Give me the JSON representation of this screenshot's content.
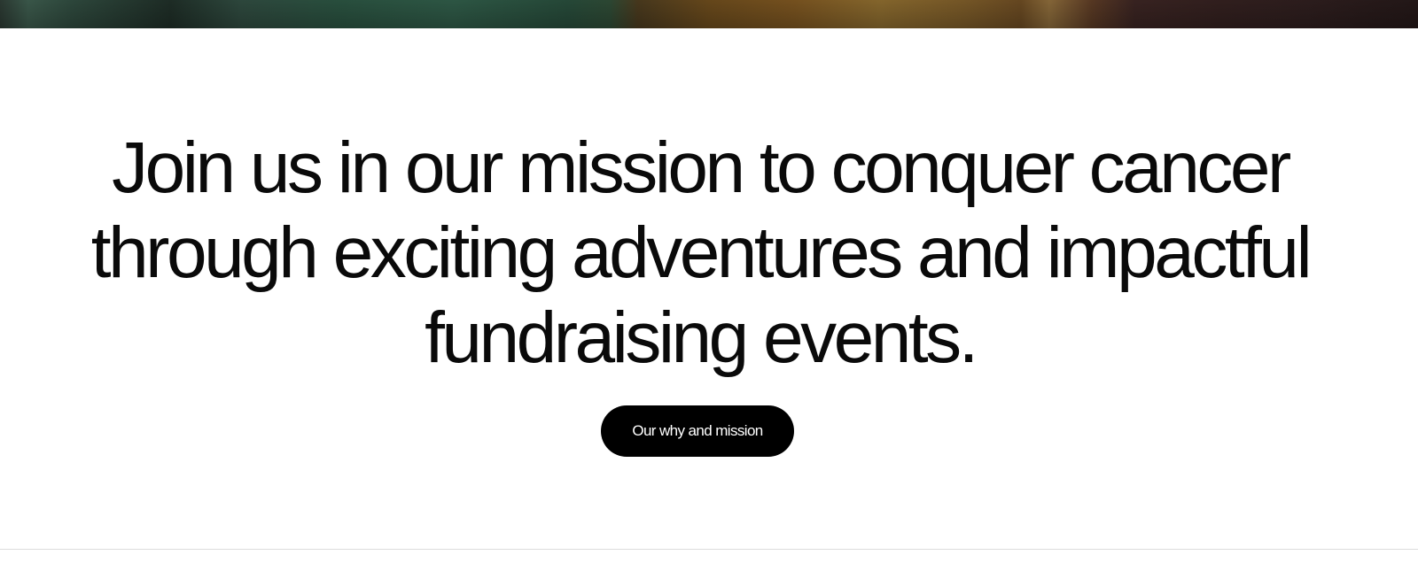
{
  "hero": {
    "image": "blurred-photo-strip"
  },
  "mission": {
    "headline": "Join us in our mission to conquer cancer through exciting adventures and impactful fundraising events.",
    "cta_label": "Our why and mission"
  },
  "colors": {
    "background": "#ffffff",
    "text": "#0a0a0a",
    "button_bg": "#000000",
    "button_text": "#ffffff",
    "divider": "#dcdcdc"
  }
}
